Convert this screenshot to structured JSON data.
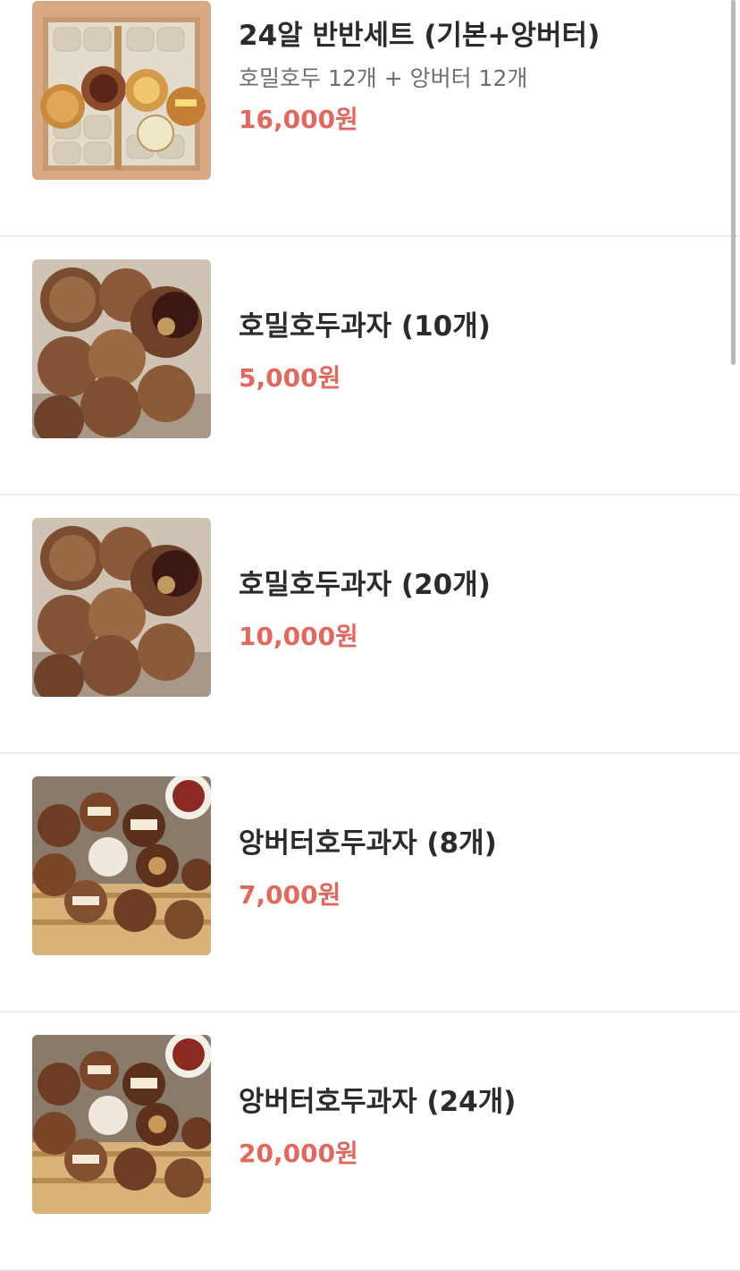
{
  "menu": {
    "items": [
      {
        "name": "24알 반반세트 (기본+앙버터)",
        "description": "호밀호두 12개 + 앙버터 12개",
        "price": "16,000원",
        "image_icon": "gift-box-photo-icon"
      },
      {
        "name": "호밀호두과자 (10개)",
        "price": "5,000원",
        "image_icon": "walnut-cake-photo-icon"
      },
      {
        "name": "호밀호두과자 (20개)",
        "price": "10,000원",
        "image_icon": "walnut-cake-photo-icon"
      },
      {
        "name": "앙버터호두과자 (8개)",
        "price": "7,000원",
        "image_icon": "anbutter-walnut-photo-icon"
      },
      {
        "name": "앙버터호두과자 (24개)",
        "price": "20,000원",
        "image_icon": "anbutter-walnut-photo-icon"
      }
    ]
  },
  "colors": {
    "price": "#e2675c",
    "title": "#2b2b2b",
    "description": "#6e6e6e",
    "divider": "#ececec"
  }
}
